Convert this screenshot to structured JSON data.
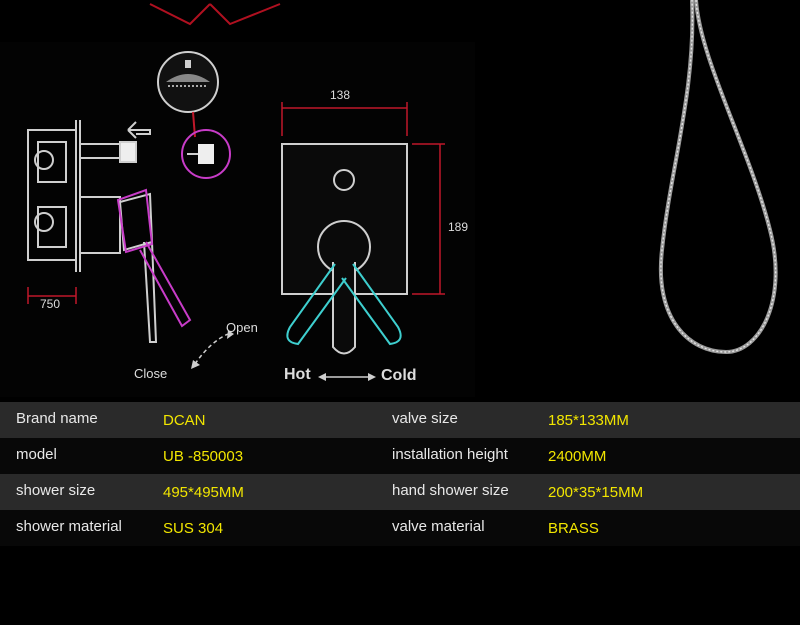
{
  "diagram": {
    "dim_width": "138",
    "dim_height": "189",
    "dim_depth": "750",
    "label_open": "Open",
    "label_close": "Close",
    "label_hot": "Hot",
    "label_cold": "Cold"
  },
  "specs": [
    {
      "label_left": "Brand name",
      "value_left": "DCAN",
      "label_right": "valve size",
      "value_right": "185*133MM"
    },
    {
      "label_left": "model",
      "value_left": "UB -850003",
      "label_right": "installation height",
      "value_right": "2400MM"
    },
    {
      "label_left": "shower size",
      "value_left": "495*495MM",
      "label_right": "hand shower size",
      "value_right": "200*35*15MM"
    },
    {
      "label_left": "shower material",
      "value_left": "SUS 304",
      "label_right": "valve material",
      "value_right": "BRASS"
    }
  ],
  "colors": {
    "label": "#e8e8e8",
    "value": "#f2e600",
    "row_shade": "#2a2a2a",
    "dimension_line": "#c0182a",
    "handle_outline": "#3ecfcf",
    "side_handle": "#c83cc8"
  }
}
